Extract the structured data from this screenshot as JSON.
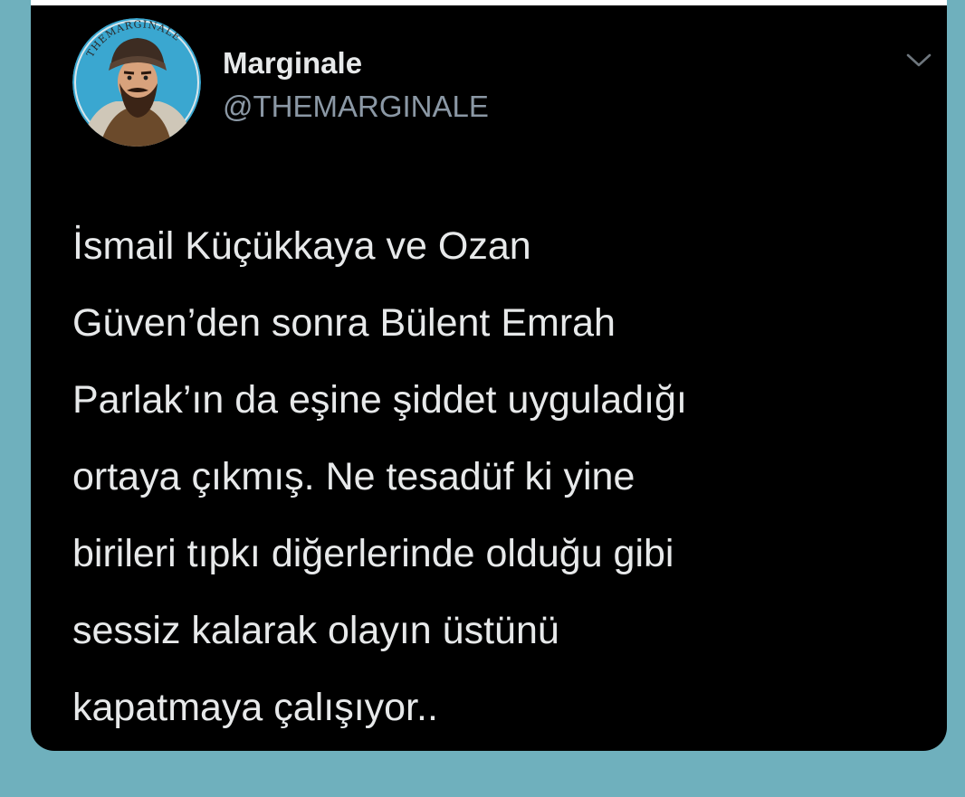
{
  "author": {
    "display_name": "Marginale",
    "handle": "@THEMARGINALE",
    "avatar_text": "THEMARGINALE"
  },
  "menu": {
    "icon": "chevron-down-icon"
  },
  "tweet": {
    "lines": [
      "İsmail Küçükkaya ve Ozan",
      "Güven’den sonra Bülent Emrah",
      "Parlak’ın da eşine şiddet uyguladığı",
      "ortaya çıkmış. Ne tesadüf ki yine",
      "birileri tıpkı diğerlerinde olduğu gibi",
      "sessiz kalarak olayın üstünü",
      "kapatmaya çalışıyor.."
    ]
  },
  "colors": {
    "page_background": "#6fb0bd",
    "card_background": "#000000",
    "primary_text": "#e7e9ea",
    "secondary_text": "#8b98a5",
    "avatar_background": "#3aa7d0"
  }
}
